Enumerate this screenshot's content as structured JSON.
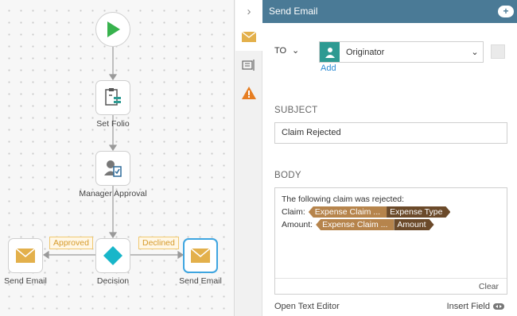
{
  "workflow": {
    "nodes": {
      "set_folio": "Set Folio",
      "manager_approval": "Manager Approval",
      "decision": "Decision",
      "send_email_left": "Send Email",
      "send_email_right": "Send Email"
    },
    "lanes": {
      "approved": "Approved",
      "declined": "Declined"
    }
  },
  "panel": {
    "title": "Send Email",
    "to": {
      "label": "TO",
      "value": "Originator",
      "add_link": "Add"
    },
    "subject": {
      "label": "SUBJECT",
      "value": "Claim Rejected"
    },
    "body": {
      "label": "BODY",
      "line1": "The following claim was rejected:",
      "claim_label": "Claim:",
      "claim_ref1": "Expense Claim ...",
      "claim_ref2": "Expense Type",
      "amount_label": "Amount:",
      "amount_ref1": "Expense Claim ...",
      "amount_ref2": "Amount",
      "clear": "Clear"
    },
    "footer": {
      "open_text_editor": "Open Text Editor",
      "insert_field": "Insert Field"
    }
  },
  "colors": {
    "header": "#4a7a96",
    "start": "#37b24d",
    "email": "#e3b04b",
    "decision": "#18b6c9",
    "warning": "#e67e22",
    "selected_border": "#3ea5e0"
  }
}
